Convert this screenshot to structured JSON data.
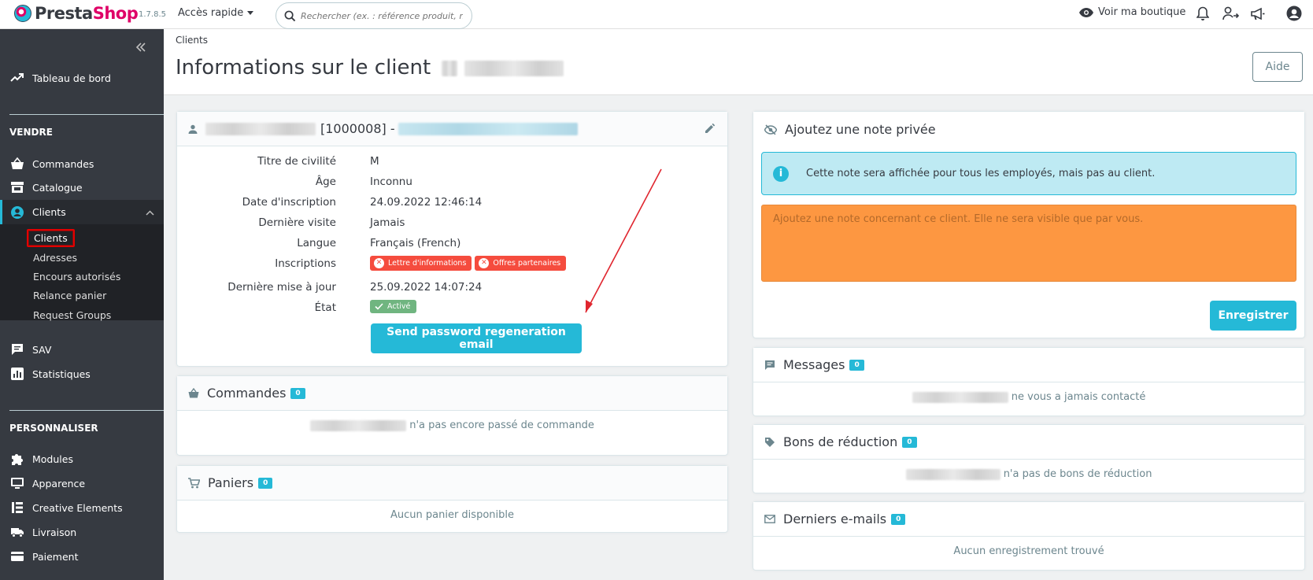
{
  "header": {
    "brand_presta": "Presta",
    "brand_shop": "Shop",
    "version": "1.7.8.5",
    "quick_access": "Accès rapide",
    "search_placeholder": "Rechercher (ex. : référence produit, no",
    "view_shop": "Voir ma boutique"
  },
  "sidebar": {
    "dashboard": "Tableau de bord",
    "section_sell": "VENDRE",
    "orders": "Commandes",
    "catalog": "Catalogue",
    "customers": "Clients",
    "sub_customers": "Clients",
    "sub_addresses": "Adresses",
    "sub_outstanding": "Encours autorisés",
    "sub_carts": "Relance panier",
    "sub_groups": "Request Groups",
    "sav": "SAV",
    "stats": "Statistiques",
    "section_customize": "PERSONNALISER",
    "modules": "Modules",
    "appearance": "Apparence",
    "creative": "Creative Elements",
    "shipping": "Livraison",
    "payment": "Paiement"
  },
  "page": {
    "breadcrumb": "Clients",
    "title": "Informations sur le client",
    "help": "Aide"
  },
  "customer_card": {
    "id": "[1000008] -",
    "rows": [
      {
        "label": "Titre de civilité",
        "value": "M"
      },
      {
        "label": "Âge",
        "value": "Inconnu"
      },
      {
        "label": "Date d'inscription",
        "value": "24.09.2022 12:46:14"
      },
      {
        "label": "Dernière visite",
        "value": "Jamais"
      },
      {
        "label": "Langue",
        "value": "Français (French)"
      },
      {
        "label": "Inscriptions",
        "value": ""
      },
      {
        "label": "Dernière mise à jour",
        "value": "25.09.2022 14:07:24"
      },
      {
        "label": "État",
        "value": ""
      }
    ],
    "newsletter": "Lettre d'informations",
    "partners": "Offres partenaires",
    "status": "Activé",
    "reset_button": "Send password regeneration email"
  },
  "orders_card": {
    "title": "Commandes",
    "count": "0",
    "empty": "n'a pas encore passé de commande"
  },
  "carts_card": {
    "title": "Paniers",
    "count": "0",
    "empty": "Aucun panier disponible"
  },
  "note_card": {
    "title": "Ajoutez une note privée",
    "info": "Cette note sera affichée pour tous les employés, mais pas au client.",
    "placeholder": "Ajoutez une note concernant ce client. Elle ne sera visible que par vous.",
    "save": "Enregistrer"
  },
  "messages_card": {
    "title": "Messages",
    "count": "0",
    "empty": "ne vous a jamais contacté"
  },
  "vouchers_card": {
    "title": "Bons de réduction",
    "count": "0",
    "empty": "n'a pas de bons de réduction"
  },
  "emails_card": {
    "title": "Derniers e-mails",
    "count": "0",
    "empty": "Aucun enregistrement trouvé"
  },
  "colors": {
    "accent": "#25b9d7",
    "brand": "#df0067",
    "sidebar": "#363a41",
    "danger": "#f54c3e",
    "success": "#70b580",
    "note": "#fd9741"
  }
}
